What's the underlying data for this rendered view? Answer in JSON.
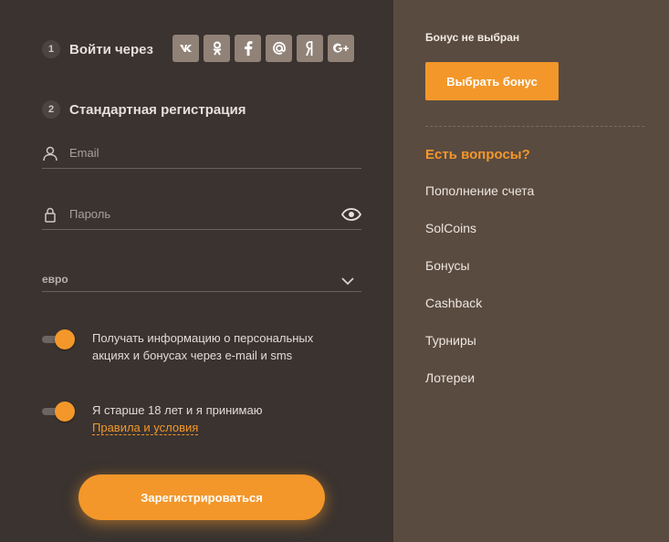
{
  "login": {
    "step1_num": "1",
    "step1_label": "Войти через",
    "socials": [
      {
        "icon": "vk-icon",
        "glyph": "vk"
      },
      {
        "icon": "odnoklassniki-icon",
        "glyph": "ок"
      },
      {
        "icon": "facebook-icon",
        "glyph": "f"
      },
      {
        "icon": "mail-icon",
        "glyph": "@"
      },
      {
        "icon": "yandex-icon",
        "glyph": "Я"
      },
      {
        "icon": "google-plus-icon",
        "glyph": "G+"
      }
    ]
  },
  "register": {
    "step2_num": "2",
    "step2_label": "Стандартная регистрация",
    "email_placeholder": "Email",
    "password_placeholder": "Пароль",
    "currency_value": "евро",
    "consent_marketing": "Получать информацию о персональных акциях и бонусах через e-mail и sms",
    "consent_age": "Я старше 18 лет и я принимаю",
    "terms_link": "Правила и условия",
    "submit_label": "Зарегистрироваться"
  },
  "sidebar": {
    "bonus_status": "Бонус не выбран",
    "bonus_button": "Выбрать бонус",
    "faq_title": "Есть вопросы?",
    "faq_items": [
      "Пополнение счета",
      "SolCoins",
      "Бонусы",
      "Cashback",
      "Турниры",
      "Лотереи"
    ]
  },
  "colors": {
    "accent": "#f3972a",
    "left_bg": "#3a3330",
    "right_bg": "#5a4b40"
  }
}
